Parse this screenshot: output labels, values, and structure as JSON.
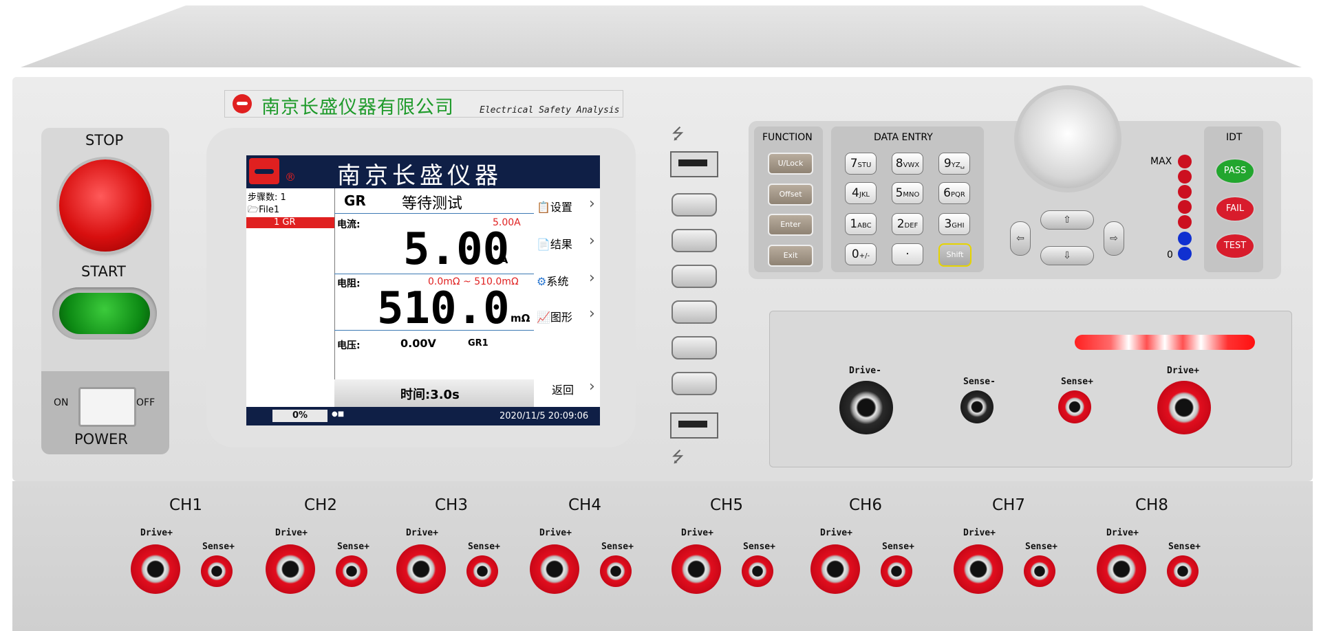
{
  "brand": {
    "company": "南京长盛仪器有限公司",
    "subtitle": "Electrical Safety Analysis"
  },
  "left_panel": {
    "stop": "STOP",
    "start": "START",
    "on": "ON",
    "off": "OFF",
    "power": "POWER"
  },
  "screen": {
    "header_title": "南京长盛仪器",
    "registered": "®",
    "tree": {
      "steps": "步骤数: 1",
      "file": "File1",
      "item": "1 GR"
    },
    "mode": "GR",
    "status": "等待测试",
    "current_label": "电流:",
    "current_setting": "5.00A",
    "current_value": "5.00",
    "current_unit": "A",
    "resistance_label": "电阻:",
    "resistance_range": "0.0mΩ ~ 510.0mΩ",
    "resistance_value": "510.0",
    "resistance_unit": "mΩ",
    "voltage_label": "电压:",
    "voltage_value": "0.00V",
    "channel": "GR1",
    "time": "时间:3.0s",
    "menu": [
      "设置",
      "结果",
      "系统",
      "图形",
      "返回"
    ],
    "progress": "0%",
    "datetime": "2020/11/5 20:09:06"
  },
  "function": {
    "title": "FUNCTION",
    "keys": [
      "U/Lock",
      "Offset",
      "Enter",
      "Exit"
    ]
  },
  "data_entry": {
    "title": "DATA ENTRY",
    "keys": [
      {
        "d": "7",
        "s": "STU"
      },
      {
        "d": "8",
        "s": "VWX"
      },
      {
        "d": "9",
        "s": "YZ␣"
      },
      {
        "d": "4",
        "s": "JKL"
      },
      {
        "d": "5",
        "s": "MNO"
      },
      {
        "d": "6",
        "s": "PQR"
      },
      {
        "d": "1",
        "s": "ABC"
      },
      {
        "d": "2",
        "s": "DEF"
      },
      {
        "d": "3",
        "s": "GHI"
      },
      {
        "d": "0",
        "s": "+/-"
      },
      {
        "d": "·",
        "s": ""
      },
      {
        "d": "Shift",
        "s": ""
      }
    ]
  },
  "leds": {
    "max": "MAX",
    "zero": "0"
  },
  "idt": {
    "title": "IDT",
    "pass": "PASS",
    "fail": "FAIL",
    "test": "TEST"
  },
  "front_terminals": {
    "drive_minus": "Drive-",
    "sense_minus": "Sense-",
    "sense_plus": "Sense+",
    "drive_plus": "Drive+"
  },
  "channels": [
    {
      "name": "CH1",
      "drive": "Drive+",
      "sense": "Sense+"
    },
    {
      "name": "CH2",
      "drive": "Drive+",
      "sense": "Sense+"
    },
    {
      "name": "CH3",
      "drive": "Drive+",
      "sense": "Sense+"
    },
    {
      "name": "CH4",
      "drive": "Drive+",
      "sense": "Sense+"
    },
    {
      "name": "CH5",
      "drive": "Drive+",
      "sense": "Sense+"
    },
    {
      "name": "CH6",
      "drive": "Drive+",
      "sense": "Sense+"
    },
    {
      "name": "CH7",
      "drive": "Drive+",
      "sense": "Sense+"
    },
    {
      "name": "CH8",
      "drive": "Drive+",
      "sense": "Sense+"
    }
  ]
}
